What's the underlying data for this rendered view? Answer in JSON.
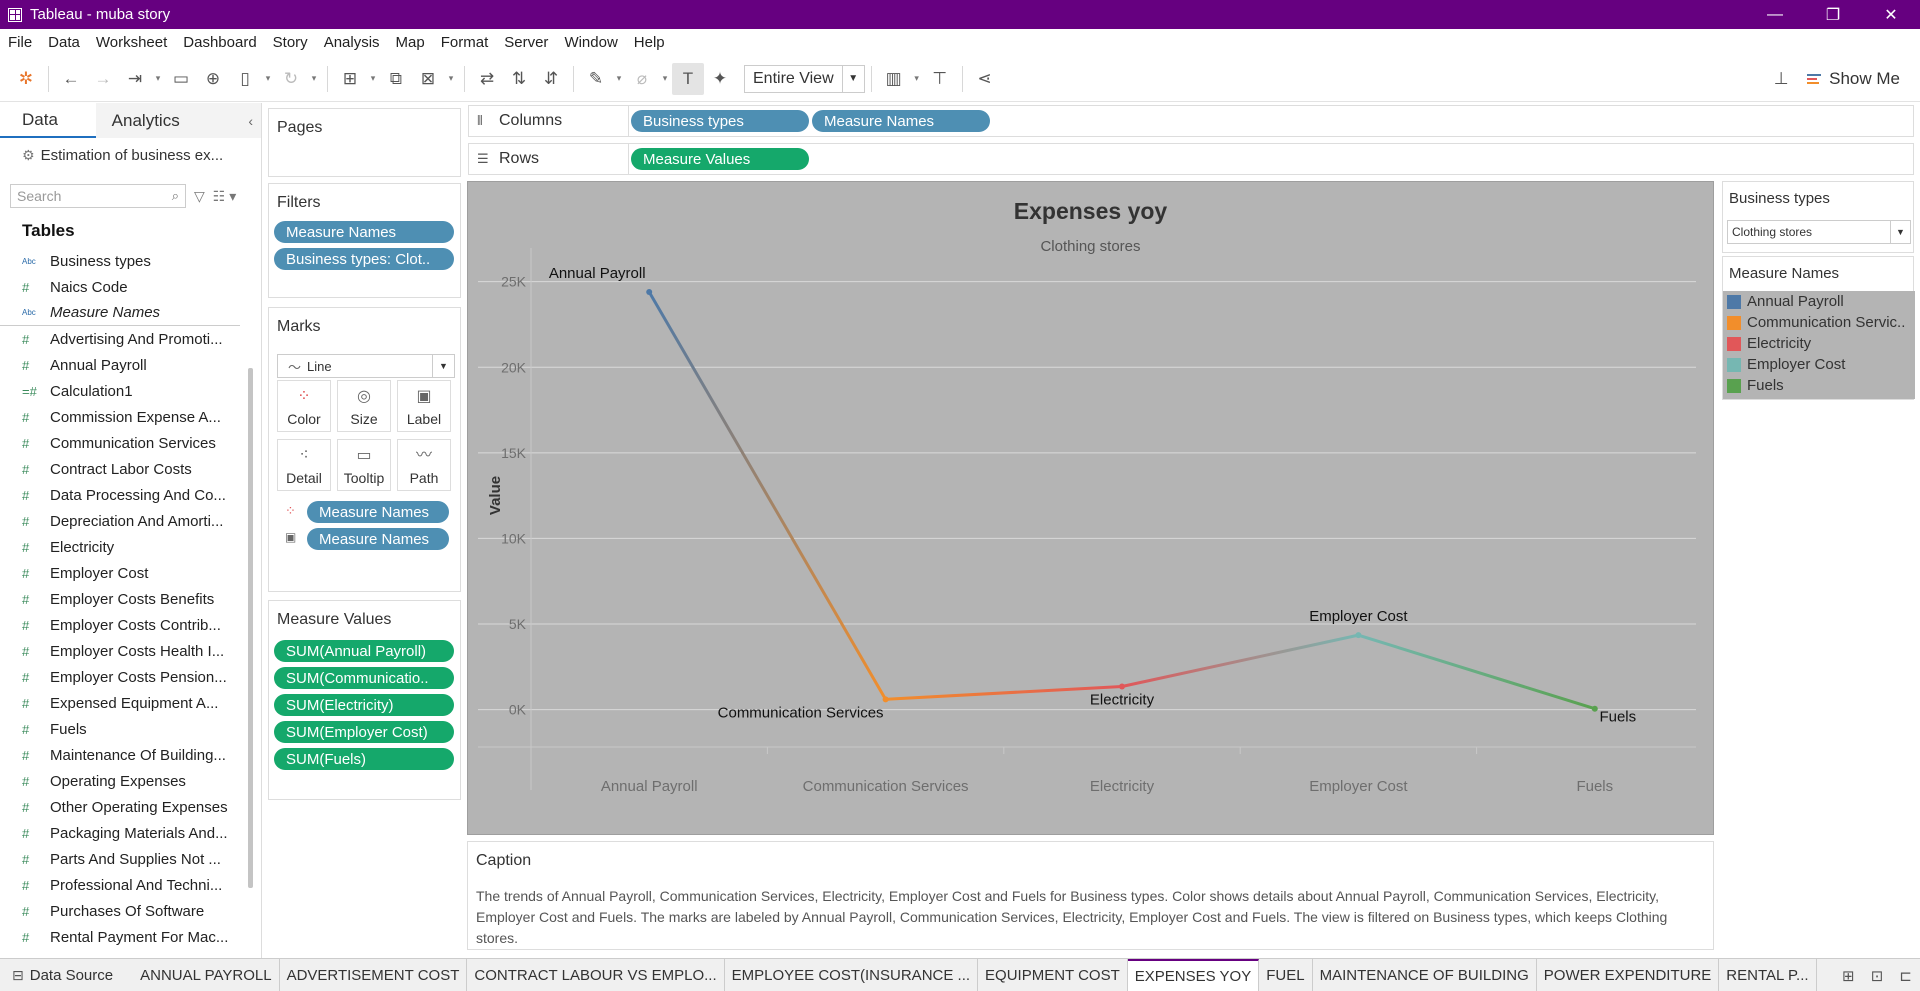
{
  "window": {
    "title": "Tableau - muba story",
    "controls": [
      "—",
      "❐",
      "✕"
    ]
  },
  "menu": [
    "File",
    "Data",
    "Worksheet",
    "Dashboard",
    "Story",
    "Analysis",
    "Map",
    "Format",
    "Server",
    "Window",
    "Help"
  ],
  "toolbar": {
    "fit_value": "Entire View",
    "show_me_label": "Show Me"
  },
  "data_pane": {
    "tab_data": "Data",
    "tab_analytics": "Analytics",
    "datasource": "Estimation of business ex...",
    "search_placeholder": "Search",
    "tables_heading": "Tables",
    "fields": [
      {
        "type": "Abc",
        "name": "Business types"
      },
      {
        "type": "#",
        "name": "Naics Code"
      },
      {
        "type": "Abc",
        "name": "Measure Names"
      },
      {
        "type": "#",
        "name": "Advertising And Promoti..."
      },
      {
        "type": "#",
        "name": "Annual Payroll"
      },
      {
        "type": "=#",
        "name": "Calculation1"
      },
      {
        "type": "#",
        "name": "Commission Expense A..."
      },
      {
        "type": "#",
        "name": "Communication Services"
      },
      {
        "type": "#",
        "name": "Contract Labor Costs"
      },
      {
        "type": "#",
        "name": "Data Processing And Co..."
      },
      {
        "type": "#",
        "name": "Depreciation And Amorti..."
      },
      {
        "type": "#",
        "name": "Electricity"
      },
      {
        "type": "#",
        "name": "Employer Cost"
      },
      {
        "type": "#",
        "name": "Employer Costs Benefits"
      },
      {
        "type": "#",
        "name": "Employer Costs Contrib..."
      },
      {
        "type": "#",
        "name": "Employer Costs Health I..."
      },
      {
        "type": "#",
        "name": "Employer Costs Pension..."
      },
      {
        "type": "#",
        "name": "Expensed Equipment A..."
      },
      {
        "type": "#",
        "name": "Fuels"
      },
      {
        "type": "#",
        "name": "Maintenance Of Building..."
      },
      {
        "type": "#",
        "name": "Operating Expenses"
      },
      {
        "type": "#",
        "name": "Other Operating Expenses"
      },
      {
        "type": "#",
        "name": "Packaging Materials And..."
      },
      {
        "type": "#",
        "name": "Parts And Supplies Not ..."
      },
      {
        "type": "#",
        "name": "Professional And Techni..."
      },
      {
        "type": "#",
        "name": "Purchases Of Software"
      },
      {
        "type": "#",
        "name": "Rental Payment For Mac..."
      }
    ]
  },
  "pages": {
    "title": "Pages"
  },
  "filters": {
    "title": "Filters",
    "pills": [
      "Measure Names",
      "Business types: Clot.."
    ]
  },
  "marks": {
    "title": "Marks",
    "type": "Line",
    "buttons": [
      "Color",
      "Size",
      "Label",
      "Detail",
      "Tooltip",
      "Path"
    ],
    "pills": [
      "Measure Names",
      "Measure Names"
    ]
  },
  "measure_values": {
    "title": "Measure Values",
    "pills": [
      "SUM(Annual Payroll)",
      "SUM(Communicatio..",
      "SUM(Electricity)",
      "SUM(Employer Cost)",
      "SUM(Fuels)"
    ]
  },
  "shelves": {
    "columns_label": "Columns",
    "columns_pills": [
      "Business types",
      "Measure Names"
    ],
    "rows_label": "Rows",
    "rows_pills": [
      "Measure Values"
    ]
  },
  "chart_data": {
    "type": "line",
    "title": "Expenses yoy",
    "subtitle": "Clothing stores",
    "xlabel": "",
    "ylabel": "Value",
    "categories": [
      "Annual Payroll",
      "Communication Services",
      "Electricity",
      "Employer Cost",
      "Fuels"
    ],
    "values": [
      24400,
      600,
      1350,
      4350,
      50
    ],
    "point_labels": [
      "Annual Payroll",
      "Communication Services",
      "Electricity",
      "Employer Cost",
      "Fuels"
    ],
    "colors": [
      "#4e79a7",
      "#f28e2b",
      "#e15759",
      "#76b7b2",
      "#59a14f"
    ],
    "yticks": [
      0,
      5000,
      10000,
      15000,
      20000,
      25000
    ],
    "ytick_labels": [
      "0K",
      "5K",
      "10K",
      "15K",
      "20K",
      "25K"
    ],
    "ylim": [
      -900,
      26500
    ],
    "grid": true,
    "background": "#b4b4b4"
  },
  "cards": {
    "business_types": {
      "title": "Business types",
      "value": "Clothing stores"
    },
    "measure_names": {
      "title": "Measure Names",
      "items": [
        {
          "label": "Annual Payroll",
          "color": "#4e79a7"
        },
        {
          "label": "Communication Servic..",
          "color": "#f28e2b"
        },
        {
          "label": "Electricity",
          "color": "#e15759"
        },
        {
          "label": "Employer Cost",
          "color": "#76b7b2"
        },
        {
          "label": "Fuels",
          "color": "#59a14f"
        }
      ]
    }
  },
  "caption": {
    "title": "Caption",
    "text": "The trends of Annual Payroll, Communication Services, Electricity, Employer Cost and Fuels for Business types.  Color shows details about Annual Payroll, Communication Services, Electricity, Employer Cost and Fuels.  The marks are labeled by Annual Payroll, Communication Services, Electricity, Employer Cost and Fuels. The view is filtered on Business types, which keeps Clothing stores."
  },
  "sheet_tabs": {
    "data_source": "Data Source",
    "tabs": [
      "ANNUAL PAYROLL",
      "ADVERTISEMENT COST",
      "CONTRACT LABOUR VS EMPLO...",
      "EMPLOYEE COST(INSURANCE ...",
      "EQUIPMENT COST",
      "EXPENSES YOY",
      "FUEL",
      "MAINTENANCE OF BUILDING",
      "POWER EXPENDITURE",
      "RENTAL P..."
    ],
    "active_index": 5
  }
}
